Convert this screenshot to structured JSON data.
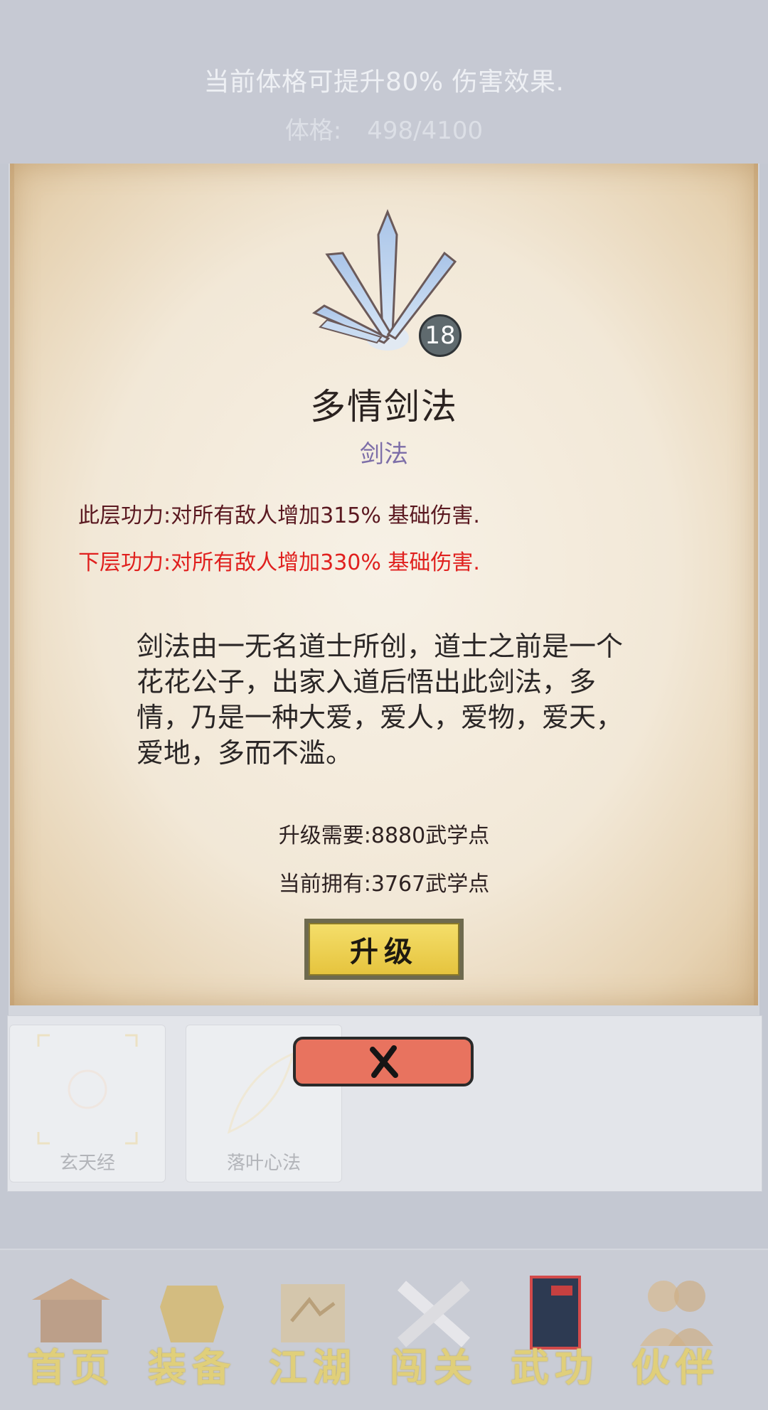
{
  "top_info": {
    "constitution_hint": "当前体格可提升80% 伤害效果.",
    "constitution_label": "体格:",
    "constitution_value": "498/4100"
  },
  "skill": {
    "level": "18",
    "name": "多情剑法",
    "type": "剑法",
    "effect_current": "此层功力:对所有敌人增加315% 基础伤害.",
    "effect_next": "下层功力:对所有敌人增加330% 基础伤害.",
    "description": "剑法由一无名道士所创，道士之前是一个花花公子，出家入道后悟出此剑法，多情，乃是一种大爱，爱人，爱物，爱天，爱地，多而不滥。",
    "upgrade_cost": "升级需要:8880武学点",
    "current_owned": "当前拥有:3767武学点",
    "upgrade_label": "升级",
    "accent_color": "#e0201e"
  },
  "skill_list": [
    {
      "name": "玄天经",
      "icon": "scroll-corner-icon"
    },
    {
      "name": "落叶心法",
      "icon": "leaf-icon"
    }
  ],
  "bottom_nav": [
    {
      "label": "首页",
      "icon": "pavilion-icon"
    },
    {
      "label": "装备",
      "icon": "armor-icon"
    },
    {
      "label": "江湖",
      "icon": "map-scroll-icon"
    },
    {
      "label": "闯关",
      "icon": "crossed-swords-icon"
    },
    {
      "label": "武功",
      "icon": "book-icon"
    },
    {
      "label": "伙伴",
      "icon": "companions-icon"
    }
  ]
}
